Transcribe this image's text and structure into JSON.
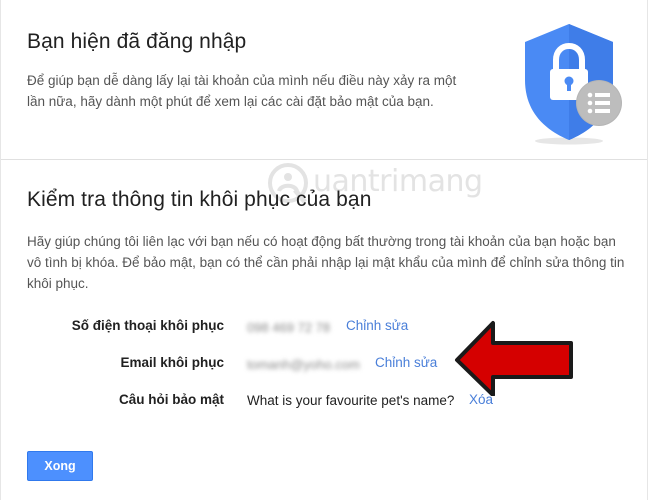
{
  "signed_in": {
    "title": "Bạn hiện đã đăng nhập",
    "description": "Để giúp bạn dễ dàng lấy lại tài khoản của mình nếu điều này xảy ra một lần nữa, hãy dành một phút để xem lại các cài đặt bảo mật của bạn."
  },
  "recovery": {
    "title": "Kiểm tra thông tin khôi phục của bạn",
    "description": "Hãy giúp chúng tôi liên lạc với bạn nếu có hoạt động bất thường trong tài khoản của bạn hoặc bạn vô tình bị khóa. Để bảo mật, bạn có thể cần phải nhập lại mật khẩu của mình để chỉnh sửa thông tin khôi phục.",
    "phone": {
      "label": "Số điện thoại khôi phục",
      "value": "098 469 72 78",
      "action": "Chỉnh sửa"
    },
    "email": {
      "label": "Email khôi phục",
      "value": "tomanh@yoho.com",
      "action": "Chỉnh sửa"
    },
    "question": {
      "label": "Câu hỏi bảo mật",
      "value": "What is your favourite pet's name?",
      "action": "Xóa"
    }
  },
  "done_button": "Xong",
  "watermark": "uantrimang",
  "colors": {
    "link": "#4a7fd9",
    "button": "#4d90fe",
    "shield": "#4a8af4",
    "arrow": "#d50000"
  }
}
